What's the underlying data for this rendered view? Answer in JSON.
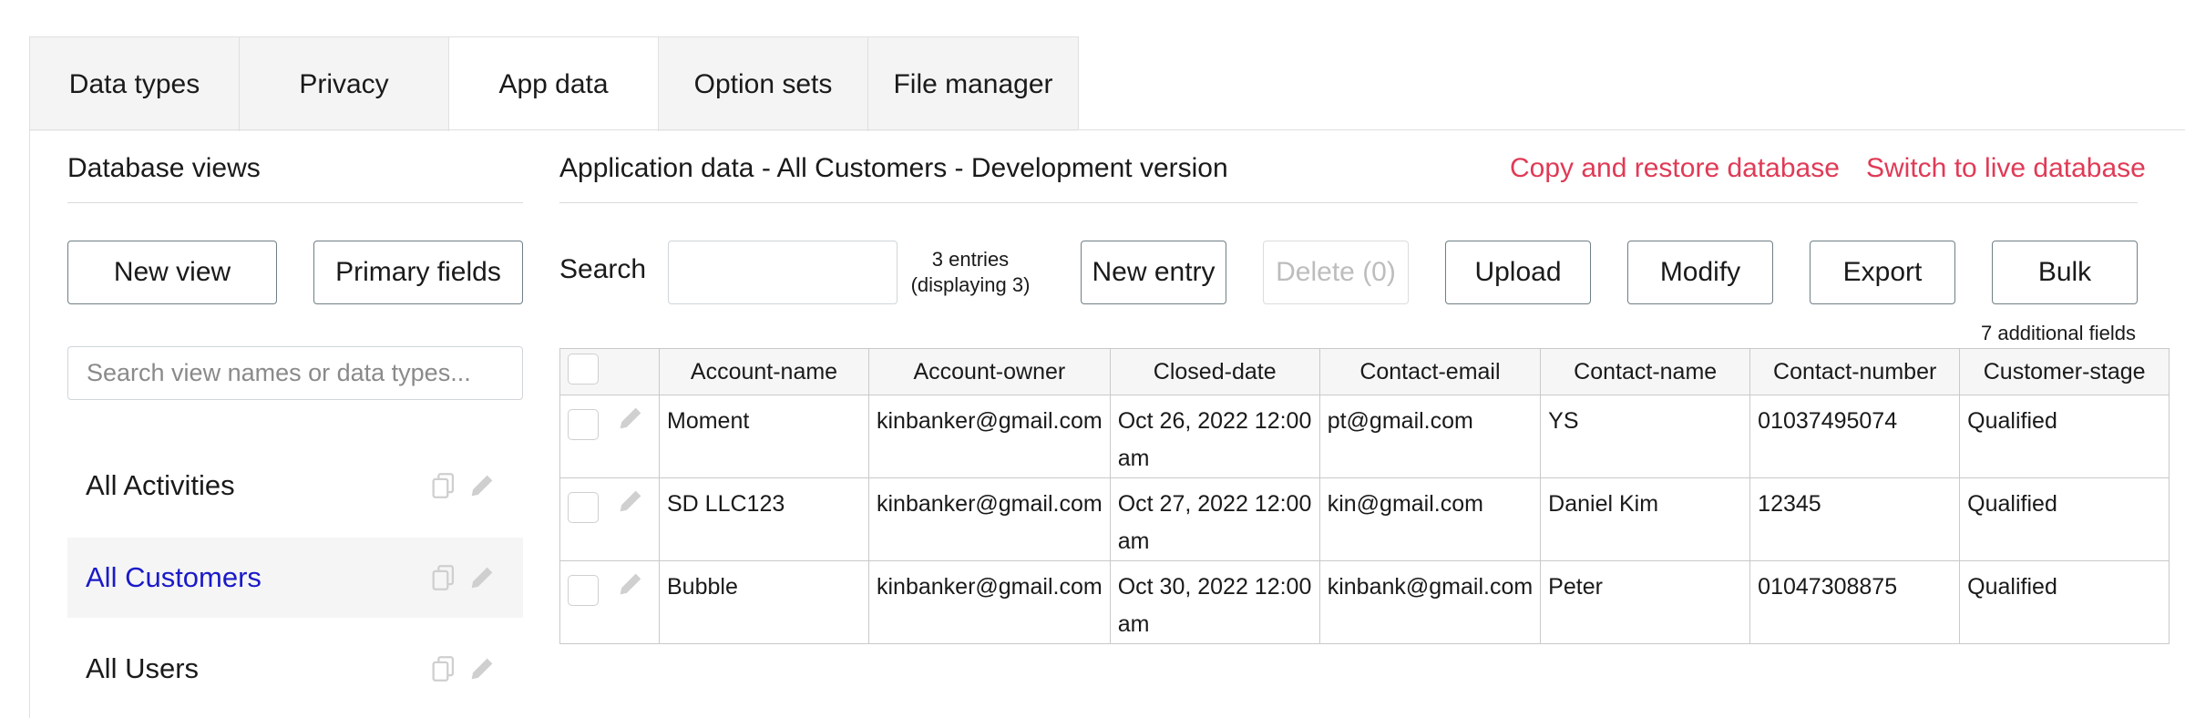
{
  "tabs": [
    {
      "label": "Data types"
    },
    {
      "label": "Privacy"
    },
    {
      "label": "App data"
    },
    {
      "label": "Option sets"
    },
    {
      "label": "File manager"
    }
  ],
  "left": {
    "title": "Database views",
    "new_view": "New view",
    "primary_fields": "Primary fields",
    "search_placeholder": "Search view names or data types...",
    "views": [
      {
        "label": "All Activities"
      },
      {
        "label": "All Customers"
      },
      {
        "label": "All Users"
      }
    ]
  },
  "main": {
    "title": "Application data - All Customers - Development version",
    "copy_restore": "Copy and restore database",
    "switch_live": "Switch to live database",
    "search_label": "Search",
    "entries_line1": "3 entries",
    "entries_line2": "(displaying 3)",
    "new_entry": "New entry",
    "delete": "Delete (0)",
    "upload": "Upload",
    "modify": "Modify",
    "export": "Export",
    "bulk": "Bulk",
    "additional_fields": "7 additional fields",
    "columns": [
      "Account-name",
      "Account-owner",
      "Closed-date",
      "Contact-email",
      "Contact-name",
      "Contact-number",
      "Customer-stage"
    ],
    "rows": [
      {
        "account_name": "Moment",
        "account_owner": "kinbanker@gmail.com",
        "closed_date": "Oct 26, 2022 12:00 am",
        "contact_email": "pt@gmail.com",
        "contact_name": "YS",
        "contact_number": "01037495074",
        "customer_stage": "Qualified"
      },
      {
        "account_name": "SD LLC123",
        "account_owner": "kinbanker@gmail.com",
        "closed_date": "Oct 27, 2022 12:00 am",
        "contact_email": "kin@gmail.com",
        "contact_name": "Daniel Kim",
        "contact_number": "12345",
        "customer_stage": "Qualified"
      },
      {
        "account_name": "Bubble",
        "account_owner": "kinbanker@gmail.com",
        "closed_date": "Oct 30, 2022 12:00 am",
        "contact_email": "kinbank@gmail.com",
        "contact_name": "Peter",
        "contact_number": "01047308875",
        "customer_stage": "Qualified"
      }
    ]
  },
  "colors": {
    "accent_link": "#e03a56",
    "selected_view": "#1a1ac8",
    "button_border": "#6f7f86"
  }
}
